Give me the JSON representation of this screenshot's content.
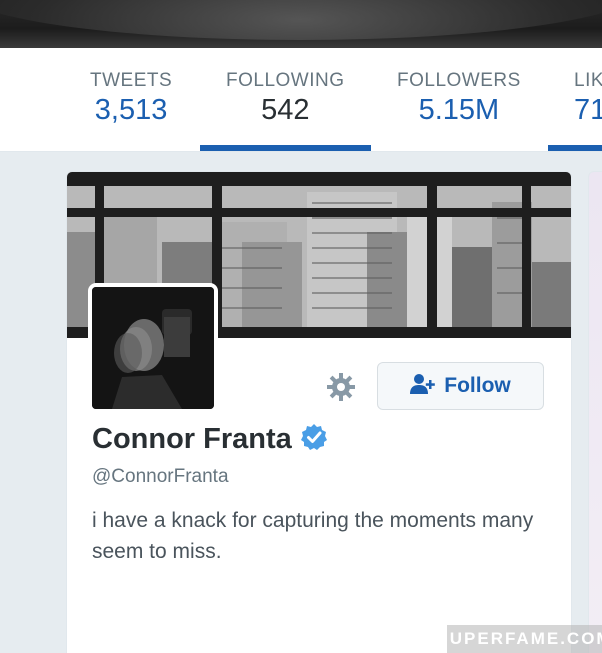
{
  "nav": {
    "items": [
      {
        "label": "TWEETS",
        "value": "3,513"
      },
      {
        "label": "FOLLOWING",
        "value": "542"
      },
      {
        "label": "FOLLOWERS",
        "value": "5.15M"
      },
      {
        "label": "LIK",
        "value": "71"
      }
    ],
    "active": "FOLLOWING"
  },
  "profile": {
    "name": "Connor Franta",
    "handle": "@ConnorFranta",
    "bio": "i have a knack for capturing the moments many seem to miss.",
    "verified": true,
    "follow_label": "Follow",
    "icons": {
      "settings": "gear-icon",
      "follow": "add-user-icon",
      "verified": "verified-badge-icon"
    }
  },
  "watermark": "SUPERFAME.COM",
  "colors": {
    "accent": "#1b5fb0",
    "verified": "#4a9ee6",
    "text_dark": "#292f33",
    "text_muted": "#66757f",
    "background": "#e6ecf0"
  }
}
